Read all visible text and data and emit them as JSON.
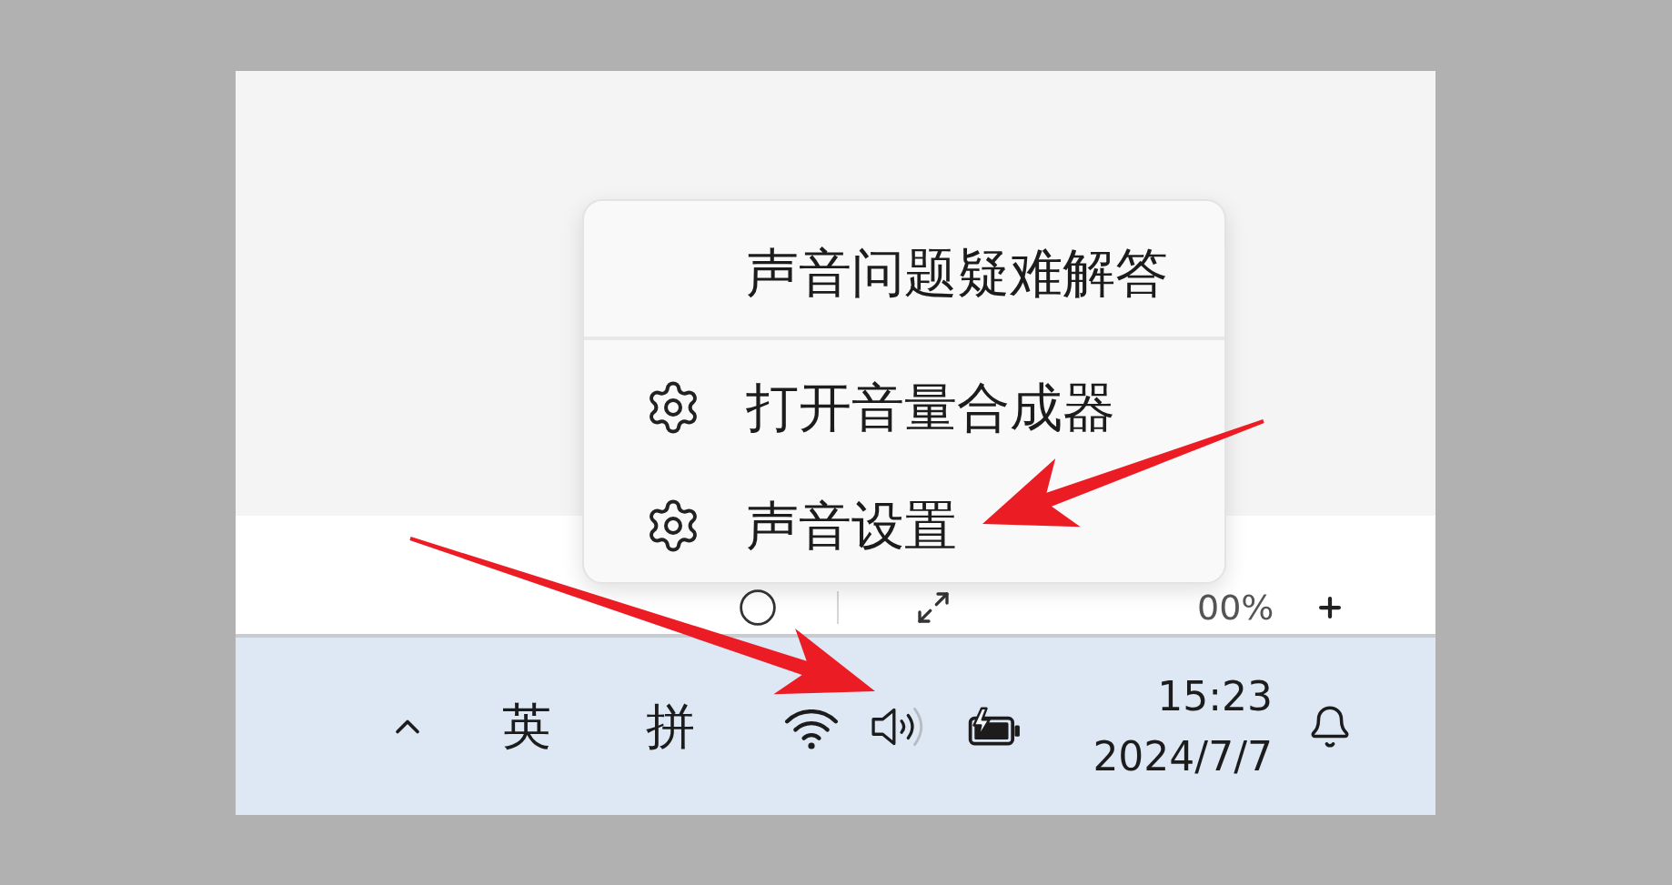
{
  "context_menu": {
    "sections": [
      {
        "items": [
          {
            "kind": "plain",
            "label": "声音问题疑难解答"
          }
        ]
      },
      {
        "items": [
          {
            "kind": "settings",
            "label": "打开音量合成器"
          },
          {
            "kind": "settings",
            "label": "声音设置"
          }
        ]
      }
    ]
  },
  "status_row": {
    "zoom_level": "00%"
  },
  "taskbar": {
    "input_language": "英",
    "input_mode": "拼",
    "time": "15:23",
    "date": "2024/7/7"
  }
}
